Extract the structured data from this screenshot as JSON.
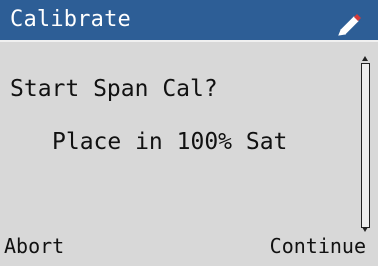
{
  "titlebar": {
    "title": "Calibrate",
    "icon": "pencil-icon"
  },
  "content": {
    "prompt": "Start Span Cal?",
    "instruction": "Place in 100% Sat"
  },
  "softkeys": {
    "left": "Abort",
    "right": "Continue"
  },
  "colors": {
    "title_bar": "#2d5e96",
    "background": "#d8d8d8",
    "title_text": "#ffffff",
    "text": "#111111",
    "pencil_body": "#ffffff",
    "pencil_tip": "#d33b3b"
  }
}
